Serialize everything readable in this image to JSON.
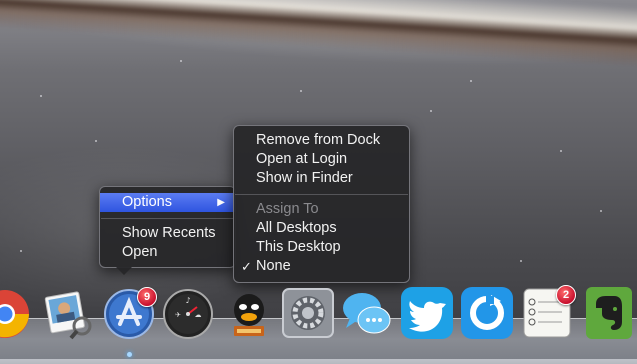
{
  "context_menu": {
    "options_label": "Options",
    "show_recents_label": "Show Recents",
    "open_label": "Open"
  },
  "options_submenu": {
    "remove_from_dock": "Remove from Dock",
    "open_at_login": "Open at Login",
    "show_in_finder": "Show in Finder",
    "assign_to_header": "Assign To",
    "all_desktops": "All Desktops",
    "this_desktop": "This Desktop",
    "none": "None",
    "none_checkmark": "✓",
    "selected_assignment": "None"
  },
  "dock": {
    "apps": [
      {
        "name": "Chrome",
        "icon": "chrome-icon"
      },
      {
        "name": "Preview",
        "icon": "preview-icon"
      },
      {
        "name": "App Store",
        "icon": "app-store-icon",
        "badge": "9"
      },
      {
        "name": "Dashboard",
        "icon": "dashboard-icon"
      },
      {
        "name": "Cyberduck",
        "icon": "cyberduck-icon"
      },
      {
        "name": "System Preferences",
        "icon": "system-preferences-icon"
      },
      {
        "name": "Messages",
        "icon": "messages-icon"
      },
      {
        "name": "Twitter",
        "icon": "twitter-icon"
      },
      {
        "name": "Reeder",
        "icon": "reeder-icon"
      },
      {
        "name": "Reminders",
        "icon": "reminders-icon",
        "badge": "2"
      },
      {
        "name": "Evernote",
        "icon": "evernote-icon"
      }
    ]
  },
  "colors": {
    "menu_highlight": "#2f55e0",
    "badge_red": "#c8102e",
    "twitter_blue": "#1ea1e6",
    "evernote_green": "#5fa83d"
  }
}
